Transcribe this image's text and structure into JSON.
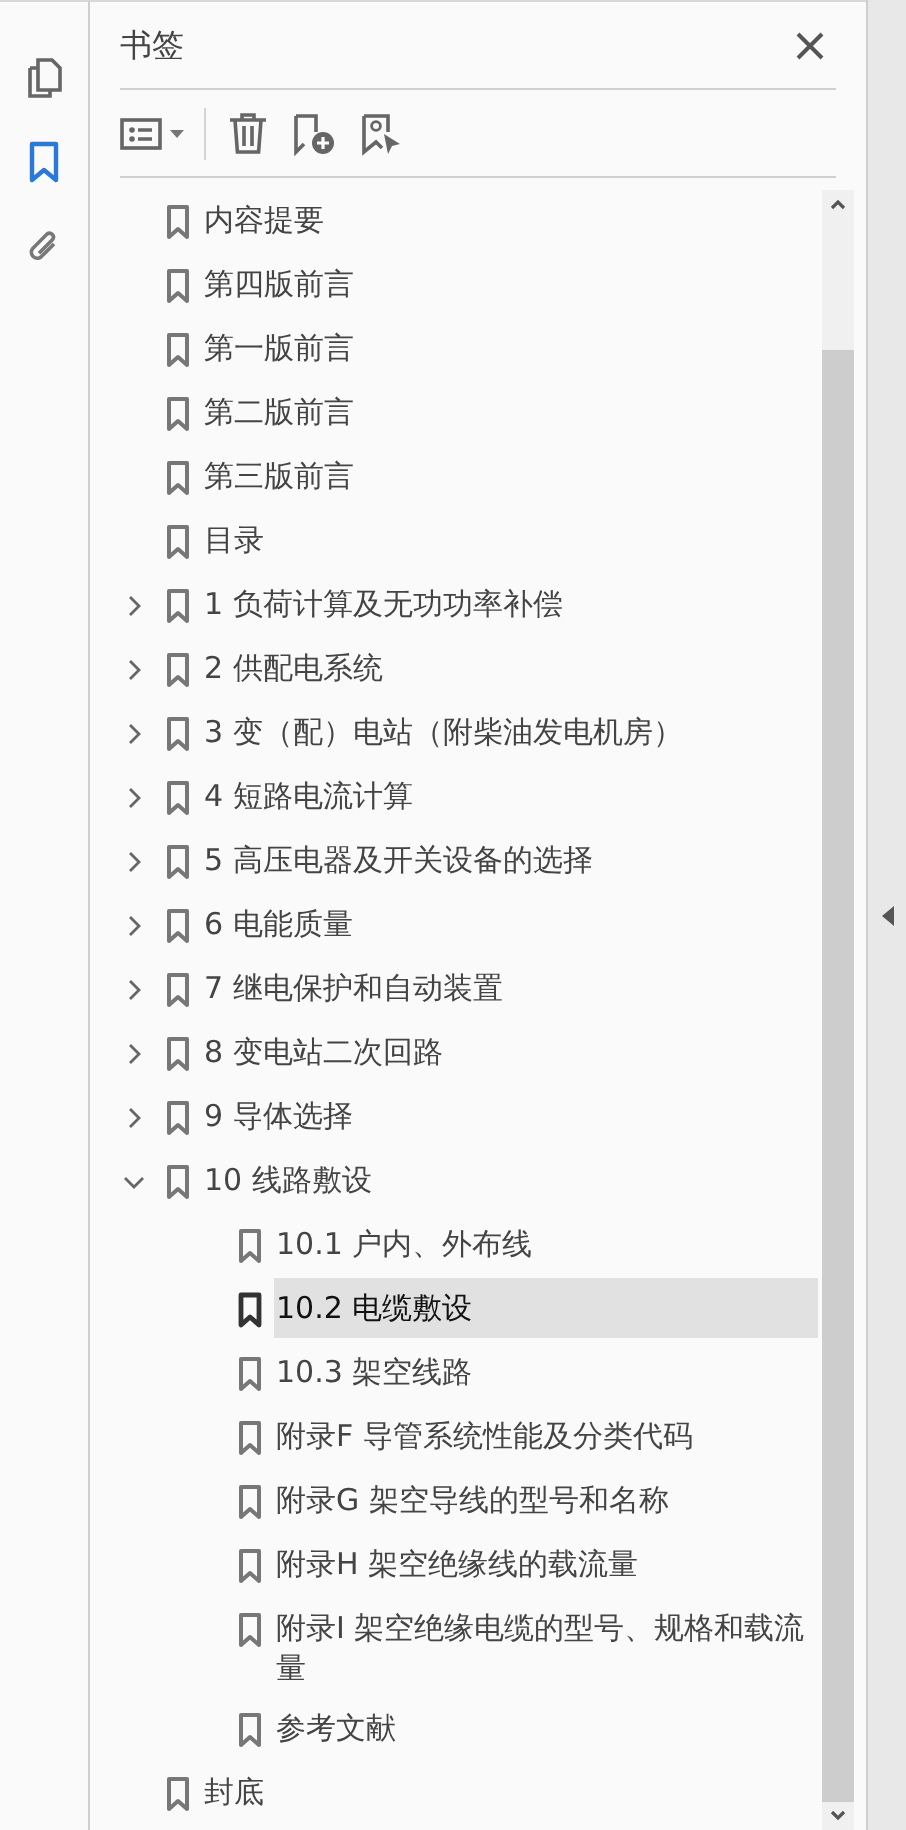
{
  "panel": {
    "title": "书签"
  },
  "bookmarks": [
    {
      "label": "内容提要",
      "selected": false
    },
    {
      "label": "第四版前言",
      "selected": false
    },
    {
      "label": "第一版前言",
      "selected": false
    },
    {
      "label": "第二版前言",
      "selected": false
    },
    {
      "label": "第三版前言",
      "selected": false
    },
    {
      "label": "目录",
      "selected": false
    },
    {
      "label": "1 负荷计算及无功功率补偿",
      "selected": false,
      "expanded": false
    },
    {
      "label": "2 供配电系统",
      "selected": false,
      "expanded": false
    },
    {
      "label": "3 变（配）电站（附柴油发电机房）",
      "selected": false,
      "expanded": false
    },
    {
      "label": "4 短路电流计算",
      "selected": false,
      "expanded": false
    },
    {
      "label": "5 高压电器及开关设备的选择",
      "selected": false,
      "expanded": false
    },
    {
      "label": "6 电能质量",
      "selected": false,
      "expanded": false
    },
    {
      "label": "7 继电保护和自动装置",
      "selected": false,
      "expanded": false
    },
    {
      "label": "8 变电站二次回路",
      "selected": false,
      "expanded": false
    },
    {
      "label": "9 导体选择",
      "selected": false,
      "expanded": false
    },
    {
      "label": "10 线路敷设",
      "selected": false,
      "expanded": true,
      "children": [
        {
          "label": "10.1 户内、外布线",
          "selected": false
        },
        {
          "label": "10.2 电缆敷设",
          "selected": true
        },
        {
          "label": "10.3 架空线路",
          "selected": false
        },
        {
          "label": "附录F 导管系统性能及分类代码",
          "selected": false
        },
        {
          "label": "附录G 架空导线的型号和名称",
          "selected": false
        },
        {
          "label": "附录H 架空绝缘线的载流量",
          "selected": false
        },
        {
          "label": "附录I 架空绝缘电缆的型号、规格和载流量",
          "selected": false
        },
        {
          "label": "参考文献",
          "selected": false
        }
      ]
    },
    {
      "label": "封底",
      "selected": false
    }
  ]
}
